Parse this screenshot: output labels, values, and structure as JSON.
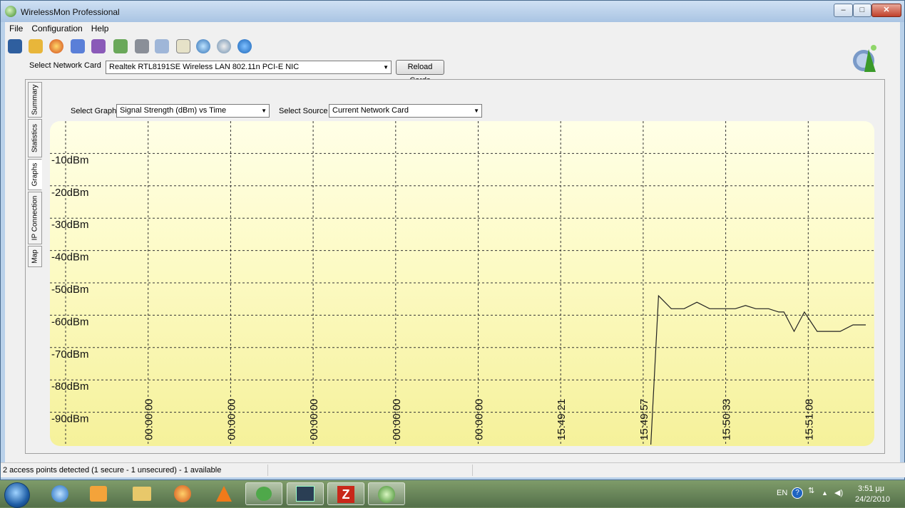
{
  "window": {
    "title": "WirelessMon Professional",
    "controls": {
      "minimize": "–",
      "maximize": "□",
      "close": "✕"
    }
  },
  "menu": [
    "File",
    "Configuration",
    "Help"
  ],
  "toolbar": {
    "icons": [
      "save-icon",
      "open-folder-icon",
      "record-icon",
      "network-icon",
      "network-alt-icon",
      "export-icon",
      "print-icon",
      "check-icon",
      "clipboard-icon",
      "globe-icon",
      "satellite-icon",
      "help-icon"
    ]
  },
  "network_card": {
    "label": "Select Network Card",
    "value": "Realtek RTL8191SE Wireless LAN 802.11n PCI-E NIC",
    "reload_label": "Reload Cards"
  },
  "tabs": [
    {
      "label": "Summary",
      "active": false
    },
    {
      "label": "Statistics",
      "active": false
    },
    {
      "label": "Graphs",
      "active": true
    },
    {
      "label": "IP Connection",
      "active": false
    },
    {
      "label": "Map",
      "active": false
    }
  ],
  "graph_controls": {
    "graph_label": "Select Graph",
    "graph_value": "Signal Strength (dBm) vs Time",
    "source_label": "Select Source",
    "source_value": "Current Network Card"
  },
  "chart_data": {
    "type": "line",
    "y_tick_labels": [
      "-10dBm",
      "-20dBm",
      "-30dBm",
      "-40dBm",
      "-50dBm",
      "-60dBm",
      "-70dBm",
      "-80dBm",
      "-90dBm"
    ],
    "y_ticks": [
      -10,
      -20,
      -30,
      -40,
      -50,
      -60,
      -70,
      -80,
      -90
    ],
    "ylim": [
      0,
      -100
    ],
    "x_tick_labels": [
      "00:00:00",
      "00:00:00",
      "00:00:00",
      "00:00:00",
      "00:00:00",
      "15:49:21",
      "15:49:57",
      "15:50:33",
      "15:51:08"
    ],
    "grid": true,
    "series": [
      {
        "x": [
          0.0,
          0.3,
          0.8,
          1.3,
          1.8,
          2.3,
          2.8,
          3.3,
          3.7,
          4.1,
          4.6,
          5.0,
          5.2,
          5.6,
          6.0,
          6.5,
          7.0,
          7.4,
          7.9,
          8.4
        ],
        "values": [
          -100,
          -54,
          -58,
          -58,
          -56,
          -58,
          -58,
          -58,
          -57,
          -58,
          -58,
          -59,
          -59,
          -65,
          -59,
          -65,
          -65,
          -65,
          -63,
          -63
        ],
        "color": "#222222"
      }
    ]
  },
  "status": {
    "text": "2 access points detected (1 secure - 1 unsecured) - 1 available"
  },
  "taskbar": {
    "apps": [
      "start-orb",
      "internet-explorer-icon",
      "media-player-icon",
      "explorer-icon",
      "firefox-icon",
      "vlc-icon",
      "messenger-icon",
      "activity-graph-icon",
      "filezilla-icon",
      "wirelessmon-icon"
    ],
    "language": "EN",
    "time": "3:51 μμ",
    "date": "24/2/2010"
  },
  "colors": {
    "chart_top": "#ffffe7",
    "chart_bottom": "#f5f19a",
    "titlebar": "#b9d1ea"
  }
}
